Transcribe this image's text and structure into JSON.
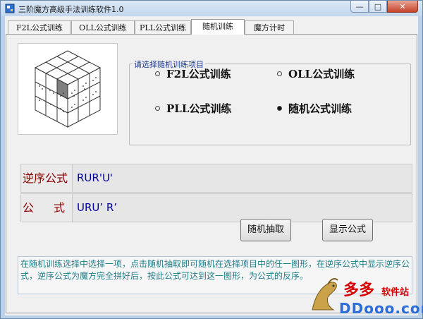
{
  "window": {
    "title": "三阶魔方高级手法训练软件1.0",
    "controls": {
      "minimize": "—",
      "maximize": "□",
      "close": "✕"
    }
  },
  "tabs": [
    {
      "label": "F2L公式训练"
    },
    {
      "label": "OLL公式训练"
    },
    {
      "label": "PLL公式训练"
    },
    {
      "label": "随机训练",
      "active": true
    },
    {
      "label": "魔方计时"
    }
  ],
  "training_options": {
    "group_label": "请选择随机训练项目",
    "options": [
      {
        "label": "F2L公式训练",
        "selected": false
      },
      {
        "label": "OLL公式训练",
        "selected": false
      },
      {
        "label": "PLL公式训练",
        "selected": false
      },
      {
        "label": "随机公式训练",
        "selected": true
      }
    ]
  },
  "formulas": {
    "reverse_label": "逆序公式",
    "reverse_value": "RUR'U'",
    "formula_label_1": "公",
    "formula_label_2": "式",
    "formula_value": "URU’ R’"
  },
  "buttons": {
    "random_draw": "随机抽取",
    "show_formula": "显示公式"
  },
  "info_text": "在随机训练选择中选择一项，点击随机抽取即可随机在选择项目中的任一图形，在逆序公式中显示逆序公式，逆序公式为魔方完全拼好后，按此公式可达到这一图形，为公式的反序。",
  "watermark": {
    "line1": "多多",
    "line1b": "软件站",
    "line2": "DDooo.com"
  },
  "colors": {
    "label_red": "#8b0000",
    "value_blue": "#0000a0",
    "info_teal": "#1f7f8b"
  }
}
